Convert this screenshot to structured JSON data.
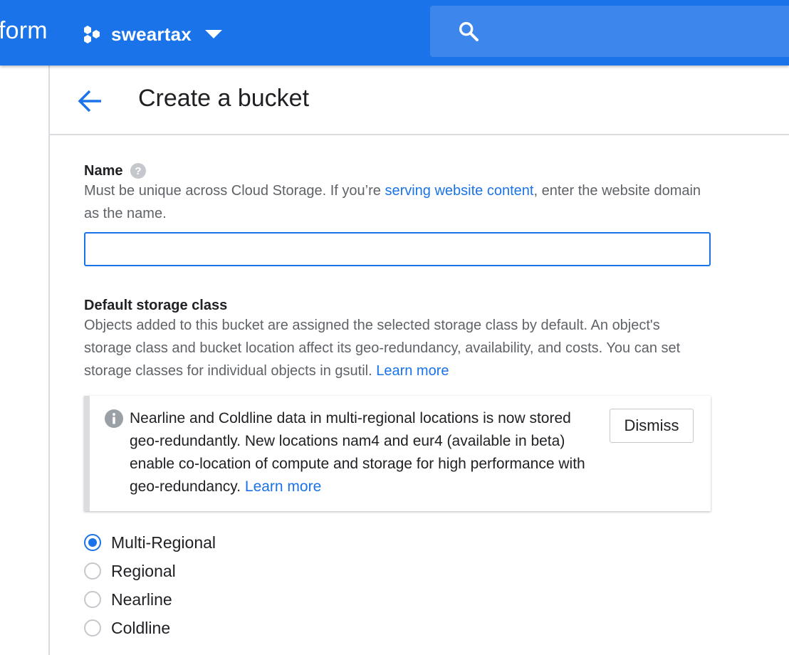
{
  "topbar": {
    "brand_fragment": "form",
    "project_name": "sweartax",
    "search_placeholder": ""
  },
  "header": {
    "title": "Create a bucket"
  },
  "name_section": {
    "label": "Name",
    "desc_before": "Must be unique across Cloud Storage. If you’re ",
    "desc_link": "serving website content",
    "desc_after": ", enter the website domain as the name.",
    "input_value": ""
  },
  "storage_section": {
    "label": "Default storage class",
    "desc_before": "Objects added to this bucket are assigned the selected storage class by default. An object's storage class and bucket location affect its geo-redundancy, availability, and costs. You can set storage classes for individual objects in gsutil. ",
    "desc_link": "Learn more"
  },
  "notice": {
    "text": "Nearline and Coldline data in multi-regional locations is now stored geo-redundantly. New locations nam4 and eur4 (available in beta) enable co-location of compute and storage for high performance with geo-redundancy. ",
    "link": "Learn more",
    "dismiss_label": "Dismiss"
  },
  "storage_classes": {
    "selected": "Multi-Regional",
    "options": [
      "Multi-Regional",
      "Regional",
      "Nearline",
      "Coldline"
    ]
  },
  "colors": {
    "accent": "#1a73e8",
    "topbar": "#1a73e8",
    "search_bg": "#3c86ec"
  },
  "icons": {
    "project": "hexagon-cluster-icon",
    "caret": "chevron-down-icon",
    "search": "search-icon",
    "back": "arrow-back-icon",
    "help": "help-icon",
    "info": "info-icon"
  }
}
